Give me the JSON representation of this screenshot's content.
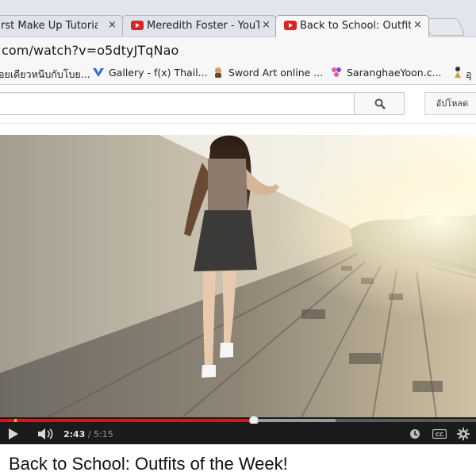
{
  "browser": {
    "tabs": [
      {
        "title": "rst Make Up Tutorial!",
        "active": false
      },
      {
        "title": "Meredith Foster - YouT",
        "active": false
      },
      {
        "title": "Back to School: Outfits",
        "active": true
      }
    ],
    "close_glyph": "×",
    "url_host": "com/watch?v=o5dtyJTqNao",
    "bookmarks": [
      {
        "label": "อยเดียวหนีบกับโบย...",
        "icon": "none"
      },
      {
        "label": "Gallery - f(x) Thail...",
        "icon": "blue-v-icon"
      },
      {
        "label": "Sword Art online ...",
        "icon": "character-icon"
      },
      {
        "label": "SaranghaeYoon.c...",
        "icon": "pink-flower-icon"
      },
      {
        "label": "อุ",
        "icon": "figure-icon"
      }
    ]
  },
  "youtube": {
    "search_placeholder": "",
    "upload_label": "อัปโหลด",
    "player": {
      "current_time": "2:43",
      "separator": " / ",
      "duration": "5:15",
      "played_fraction": 0.533,
      "buffered_fraction": 0.705
    },
    "video_title": "Back to School: Outfits of the Week!"
  },
  "colors": {
    "progress_played": "#cc181e",
    "controls_bg": "#1b1b1b",
    "tab_strip": "#e1e6ec"
  }
}
